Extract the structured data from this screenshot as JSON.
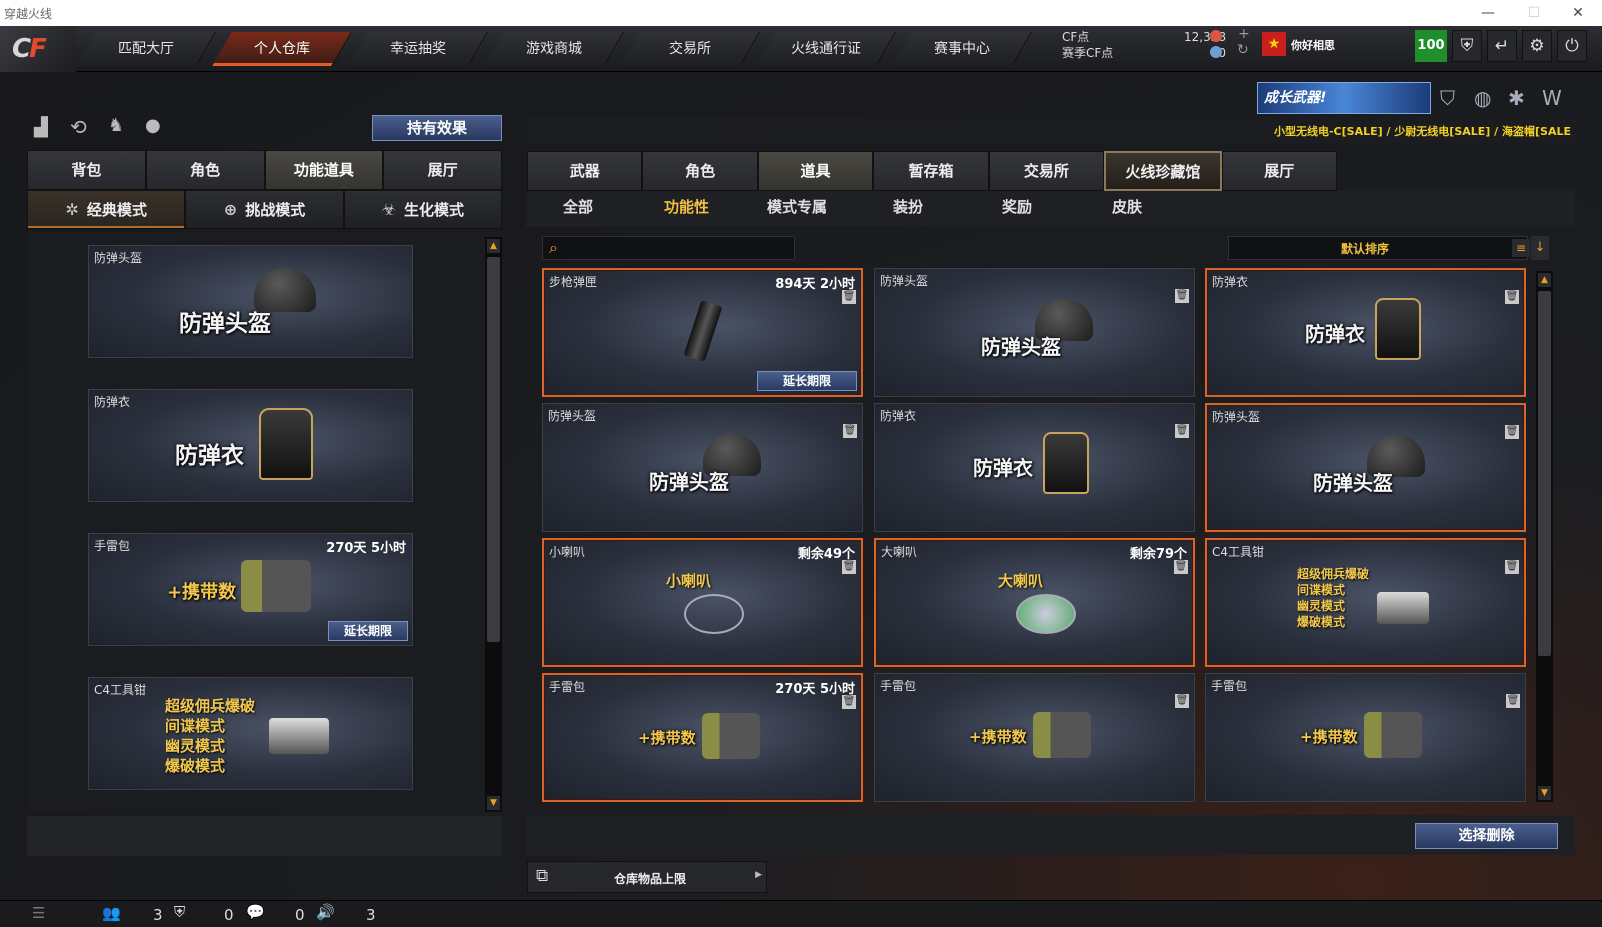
{
  "window": {
    "title": "穿越火线"
  },
  "topnav": {
    "items": [
      "匹配大厅",
      "个人仓库",
      "幸运抽奖",
      "游戏商城",
      "交易所",
      "火线通行证",
      "赛事中心"
    ],
    "cf_label": "CF点",
    "season_cf_label": "赛季CF点",
    "cf_value": "12,328",
    "season_cf_value": "0",
    "username": "你好相思",
    "level": "100"
  },
  "left": {
    "effect_button": "持有效果",
    "tabs": [
      "背包",
      "角色",
      "功能道具",
      "展厅"
    ],
    "modes": [
      "经典模式",
      "挑战模式",
      "生化模式"
    ],
    "cards": [
      {
        "title": "防弹头盔",
        "big": "防弹头盔"
      },
      {
        "title": "防弹衣",
        "big": "防弹衣"
      },
      {
        "title": "手雷包",
        "time": "270天 5小时",
        "big": "+携带数",
        "ext": "延长期限"
      },
      {
        "title": "C4工具钳",
        "lines": [
          "超级佣兵爆破",
          "间谍模式",
          "幽灵模式",
          "爆破模式"
        ]
      }
    ]
  },
  "right": {
    "banner": "成长武器!",
    "ticker": "小型无线电-C[SALE] / 少尉无线电[SALE] / 海盗帽[SALE",
    "tabs": [
      "武器",
      "角色",
      "道具",
      "暂存箱",
      "交易所",
      "火线珍藏馆",
      "展厅"
    ],
    "subtabs": [
      "全部",
      "功能性",
      "模式专属",
      "装扮",
      "奖励",
      "皮肤"
    ],
    "search_placeholder": "",
    "sort_label": "默认排序",
    "grid": [
      {
        "title": "步枪弹匣",
        "time": "894天 2小时",
        "ext": "延长期限"
      },
      {
        "title": "防弹头盔",
        "big": "防弹头盔"
      },
      {
        "title": "防弹衣",
        "big": "防弹衣"
      },
      {
        "title": "防弹头盔",
        "big": "防弹头盔"
      },
      {
        "title": "防弹衣",
        "big": "防弹衣"
      },
      {
        "title": "防弹头盔",
        "big": "防弹头盔"
      },
      {
        "title": "小喇叭",
        "time": "剩余49个",
        "big": "小喇叭"
      },
      {
        "title": "大喇叭",
        "time": "剩余79个",
        "big": "大喇叭"
      },
      {
        "title": "C4工具钳",
        "lines": [
          "超级佣兵爆破",
          "间谍模式",
          "幽灵模式",
          "爆破模式"
        ]
      },
      {
        "title": "手雷包",
        "time": "270天 5小时",
        "big": "+携带数"
      },
      {
        "title": "手雷包",
        "big": "+携带数"
      },
      {
        "title": "手雷包",
        "big": "+携带数"
      }
    ],
    "select_delete": "选择删除",
    "capacity_label": "仓库物品上限"
  },
  "status": {
    "a": "3",
    "b": "0",
    "c": "0",
    "d": "3"
  }
}
